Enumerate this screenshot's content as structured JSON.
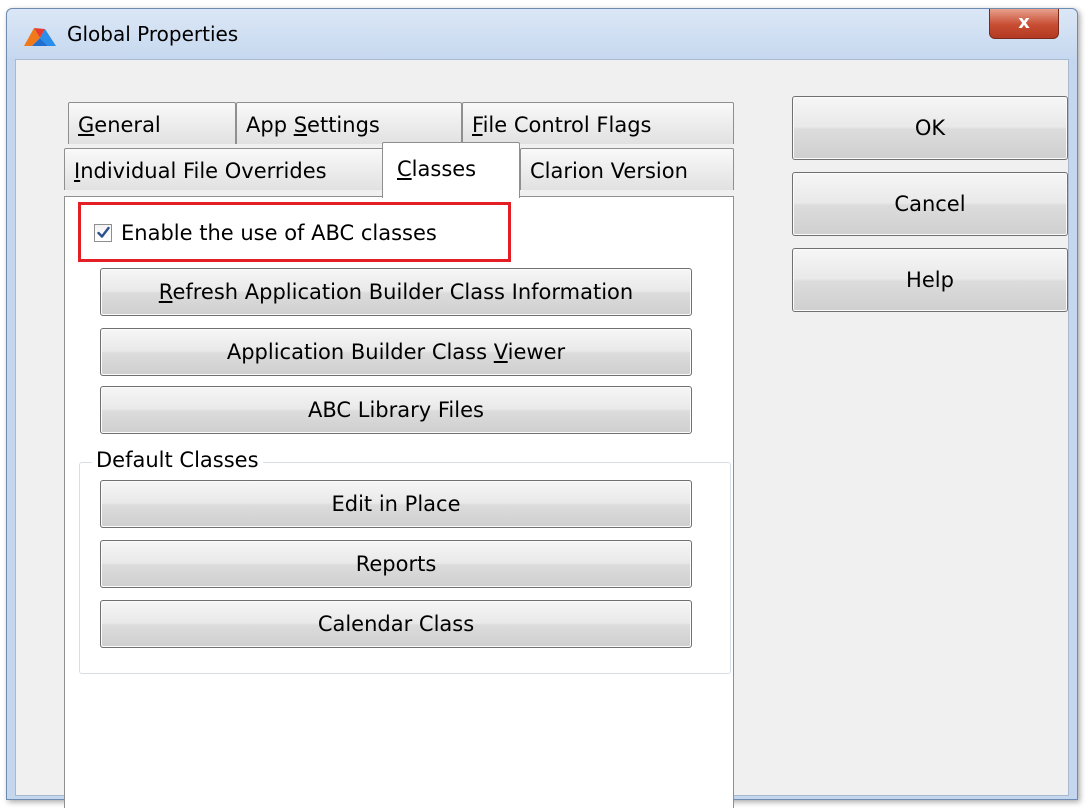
{
  "window": {
    "title": "Global Properties",
    "close_label": "x",
    "icon": "clarion-app-icon"
  },
  "tabs": {
    "row1": [
      {
        "label": "General",
        "mnemonic": "G"
      },
      {
        "label": "App Settings",
        "mnemonic": "S"
      },
      {
        "label": "File Control Flags",
        "mnemonic": "F"
      }
    ],
    "row2": [
      {
        "label": "Individual File Overrides",
        "mnemonic": "I"
      },
      {
        "label": "Classes",
        "mnemonic": "C"
      },
      {
        "label": "Clarion Version",
        "mnemonic": ""
      }
    ],
    "active": "Classes"
  },
  "classes_panel": {
    "enable_abc": {
      "label": "Enable the use of ABC classes",
      "checked": true
    },
    "buttons": [
      {
        "label": "Refresh Application Builder Class Information",
        "mnemonic": "R"
      },
      {
        "label": "Application Builder Class Viewer",
        "mnemonic": "V"
      },
      {
        "label": "ABC Library Files",
        "mnemonic": ""
      }
    ],
    "default_classes": {
      "group_label": "Default Classes",
      "buttons": [
        {
          "label": "Edit in Place"
        },
        {
          "label": "Reports"
        },
        {
          "label": "Calendar Class"
        }
      ]
    }
  },
  "dialog_buttons": {
    "ok": "OK",
    "cancel": "Cancel",
    "help": "Help"
  },
  "colors": {
    "highlight_border": "#e31e24",
    "window_frame": "#c4d7ee",
    "close_button": "#c74c32"
  }
}
